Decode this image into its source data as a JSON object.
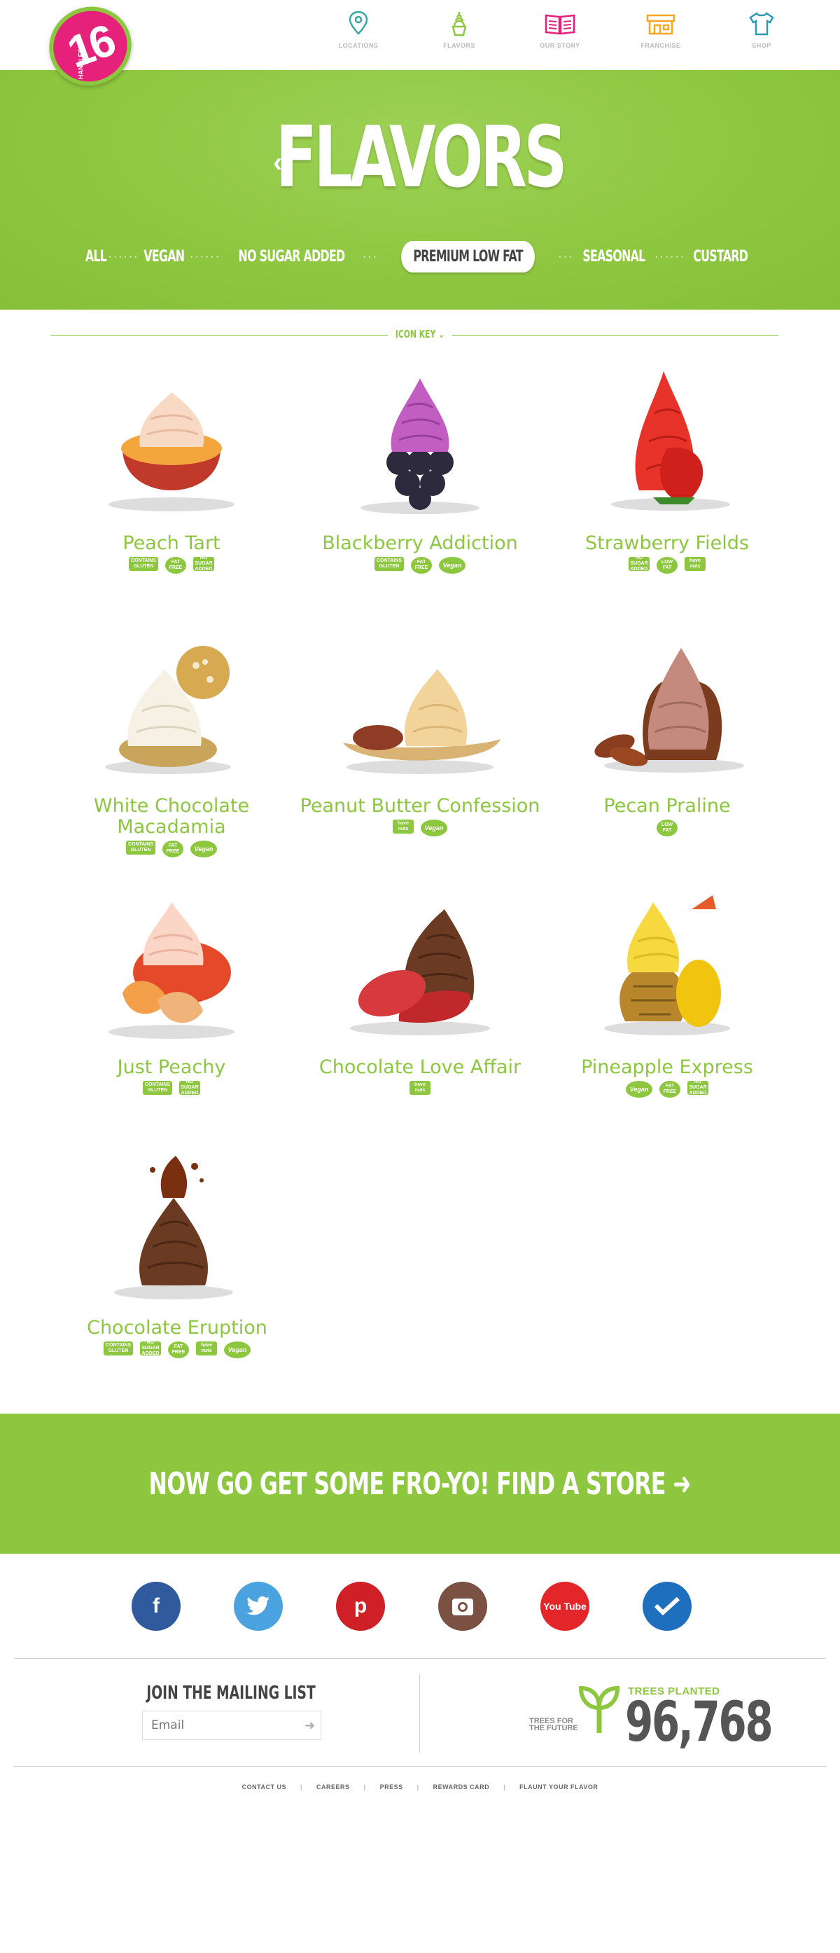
{
  "brand": {
    "logo_number": "16",
    "logo_sub": "HANDLES"
  },
  "nav": [
    {
      "label": "LOCATIONS",
      "icon": "location-pin-icon",
      "color": "#3aa6a0"
    },
    {
      "label": "FLAVORS",
      "icon": "froyo-cup-icon",
      "color": "#8dc63f"
    },
    {
      "label": "OUR STORY",
      "icon": "book-icon",
      "color": "#e5217b"
    },
    {
      "label": "FRANCHISE",
      "icon": "storefront-icon",
      "color": "#f5a623"
    },
    {
      "label": "SHOP",
      "icon": "tshirt-icon",
      "color": "#2a9bb3"
    }
  ],
  "hero": {
    "title": "FLAVORS",
    "filters": [
      "ALL",
      "VEGAN",
      "NO SUGAR ADDED",
      "PREMIUM LOW FAT",
      "SEASONAL",
      "CUSTARD"
    ],
    "selected_filter": "PREMIUM LOW FAT"
  },
  "icon_key": "ICON KEY",
  "flavors": [
    {
      "name": "Peach Tart",
      "badges": [
        "CONTAINS GLUTEN",
        "FAT FREE",
        "NO SUGAR ADDED"
      ]
    },
    {
      "name": "Blackberry Addiction",
      "badges": [
        "CONTAINS GLUTEN",
        "FAT FREE",
        "Vegan"
      ]
    },
    {
      "name": "Strawberry Fields",
      "badges": [
        "NO SUGAR ADDED",
        "LOW FAT",
        "have nuts"
      ]
    },
    {
      "name": "White Chocolate Macadamia",
      "badges": [
        "CONTAINS GLUTEN",
        "FAT FREE",
        "Vegan"
      ]
    },
    {
      "name": "Peanut Butter Confession",
      "badges": [
        "have nuts",
        "Vegan"
      ]
    },
    {
      "name": "Pecan Praline",
      "badges": [
        "LOW FAT"
      ]
    },
    {
      "name": "Just Peachy",
      "badges": [
        "CONTAINS GLUTEN",
        "NO SUGAR ADDED"
      ]
    },
    {
      "name": "Chocolate Love Affair",
      "badges": [
        "have nuts"
      ]
    },
    {
      "name": "Pineapple Express",
      "badges": [
        "Vegan",
        "FAT FREE",
        "NO SUGAR ADDED"
      ]
    },
    {
      "name": "Chocolate Eruption",
      "badges": [
        "CONTAINS GLUTEN",
        "NO SUGAR ADDED",
        "FAT FREE",
        "have nuts",
        "Vegan"
      ]
    }
  ],
  "cta": {
    "text": "NOW GO GET SOME FRO-YO! FIND A STORE"
  },
  "social": [
    {
      "name": "facebook",
      "glyph": "f",
      "color": "#2f5a9e"
    },
    {
      "name": "twitter",
      "glyph": "t",
      "color": "#4aa3df"
    },
    {
      "name": "pinterest",
      "glyph": "p",
      "color": "#cf2027"
    },
    {
      "name": "instagram",
      "glyph": "",
      "color": "#7a5142"
    },
    {
      "name": "youtube",
      "glyph": "You Tube",
      "color": "#e3262a"
    },
    {
      "name": "foursquare",
      "glyph": "",
      "color": "#1e6fbd"
    }
  ],
  "mailing": {
    "title": "JOIN THE MAILING LIST",
    "placeholder": "Email"
  },
  "trees": {
    "label": "TREES PLANTED",
    "count": "96,768",
    "logo": "TREES FOR THE FUTURE"
  },
  "footer": [
    "CONTACT US",
    "CAREERS",
    "PRESS",
    "REWARDS CARD",
    "FLAUNT YOUR FLAVOR"
  ]
}
